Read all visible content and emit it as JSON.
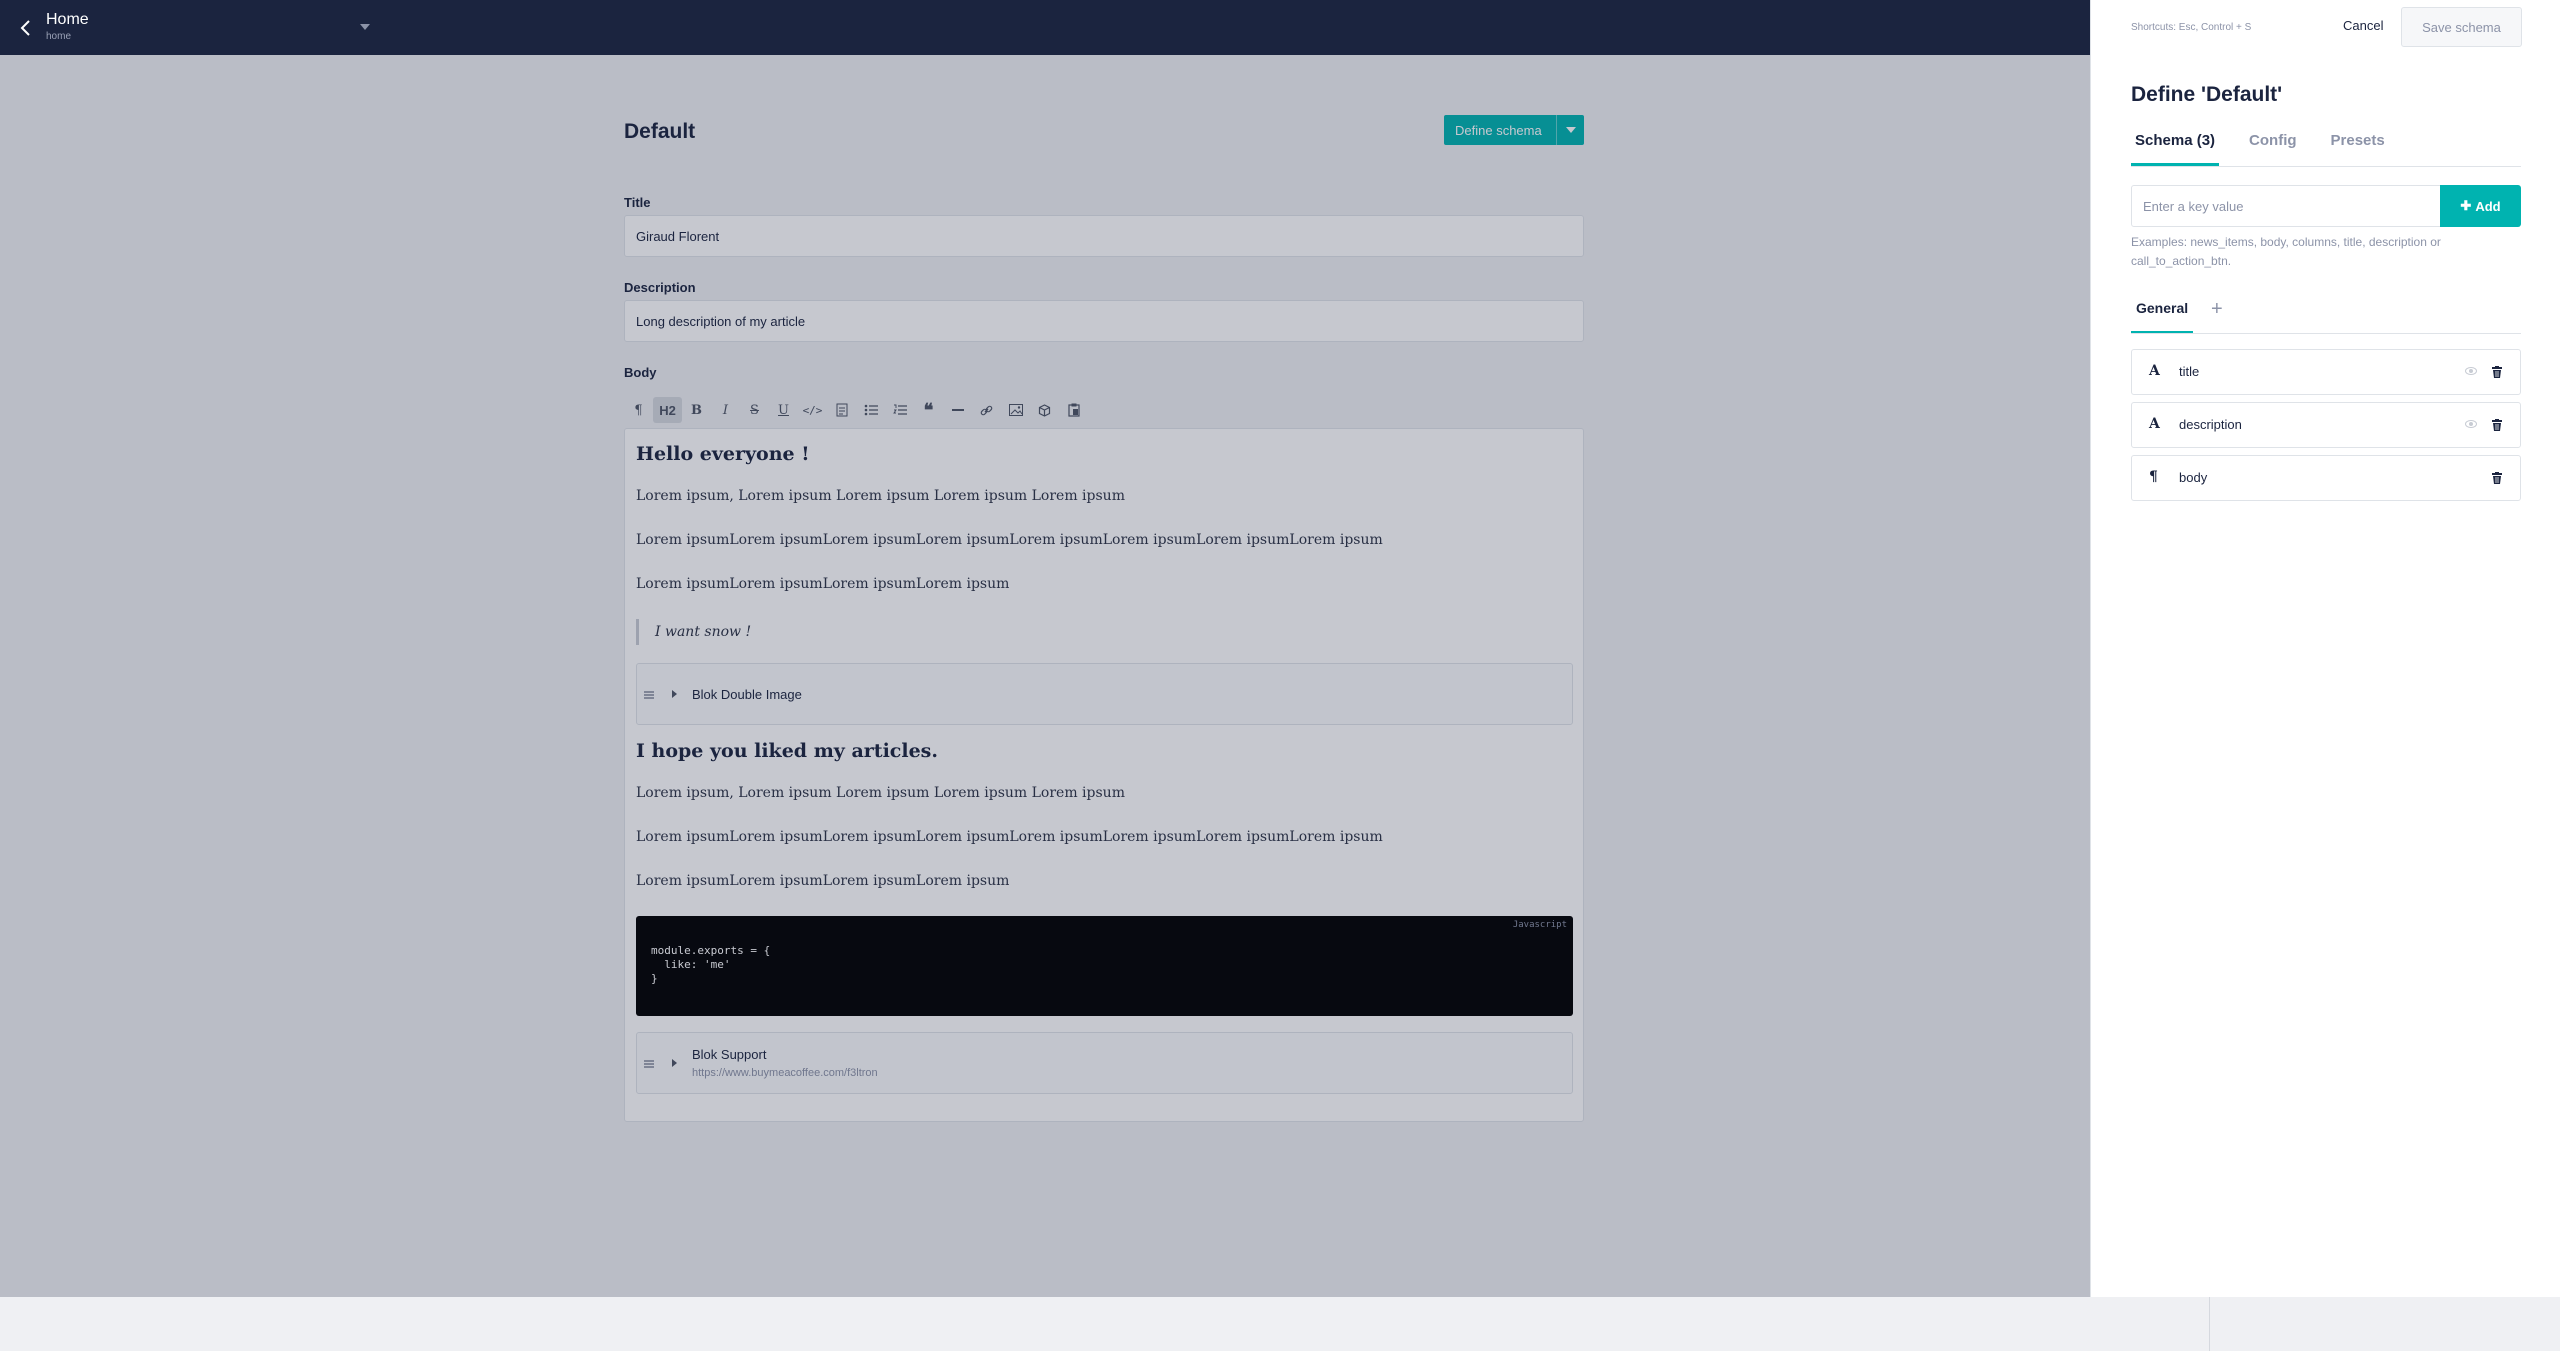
{
  "topbar": {
    "space_name": "Home",
    "space_slug": "home"
  },
  "editor": {
    "title": "Default",
    "define_button": "Define schema",
    "fields": [
      {
        "label": "Title",
        "value": "Giraud Florent"
      },
      {
        "label": "Description",
        "value": "Long description of my article"
      }
    ],
    "body_label": "Body",
    "toolbar": [
      "paragraph",
      "H2",
      "bold",
      "italic",
      "strike",
      "underline",
      "code",
      "code-block",
      "bullet-list",
      "ordered-list",
      "quote",
      "link",
      "horizontal-rule",
      "image",
      "blok",
      "paste"
    ],
    "toolbar_h2_label": "H2",
    "content": {
      "heading1": "Hello everyone !",
      "p1": "Lorem ipsum, Lorem ipsum Lorem ipsum Lorem ipsum Lorem ipsum",
      "p2": "Lorem ipsumLorem ipsumLorem ipsumLorem ipsumLorem ipsumLorem ipsumLorem ipsumLorem ipsum",
      "p3": "Lorem ipsumLorem ipsumLorem ipsumLorem ipsum",
      "quote": "I want snow !",
      "blok1": "Blok Double Image",
      "heading2": "I hope you liked my articles.",
      "p4": "Lorem ipsum, Lorem ipsum Lorem ipsum Lorem ipsum Lorem ipsum",
      "p5": "Lorem ipsumLorem ipsumLorem ipsumLorem ipsumLorem ipsumLorem ipsumLorem ipsumLorem ipsum",
      "p6": "Lorem ipsumLorem ipsumLorem ipsumLorem ipsum",
      "code_lang": "Javascript",
      "code": "module.exports = {\n  like: 'me'\n}",
      "blok2": "Blok Support",
      "blok2_url": "https://www.buymeacoffee.com/f3ltron"
    }
  },
  "panel": {
    "shortcuts": "Shortcuts: Esc, Control + S",
    "cancel": "Cancel",
    "save": "Save schema",
    "title": "Define 'Default'",
    "tabs": [
      "Schema (3)",
      "Config",
      "Presets"
    ],
    "key_placeholder": "Enter a key value",
    "add_label": "Add",
    "examples": "Examples: news_items, body, columns, title, description or call_to_action_btn.",
    "group": "General",
    "schema_fields": [
      {
        "icon": "A",
        "name": "title"
      },
      {
        "icon": "A",
        "name": "description"
      },
      {
        "icon": "¶",
        "name": "body"
      }
    ]
  },
  "colors": {
    "navy": "#1b243f",
    "accent": "#00b3b0"
  }
}
